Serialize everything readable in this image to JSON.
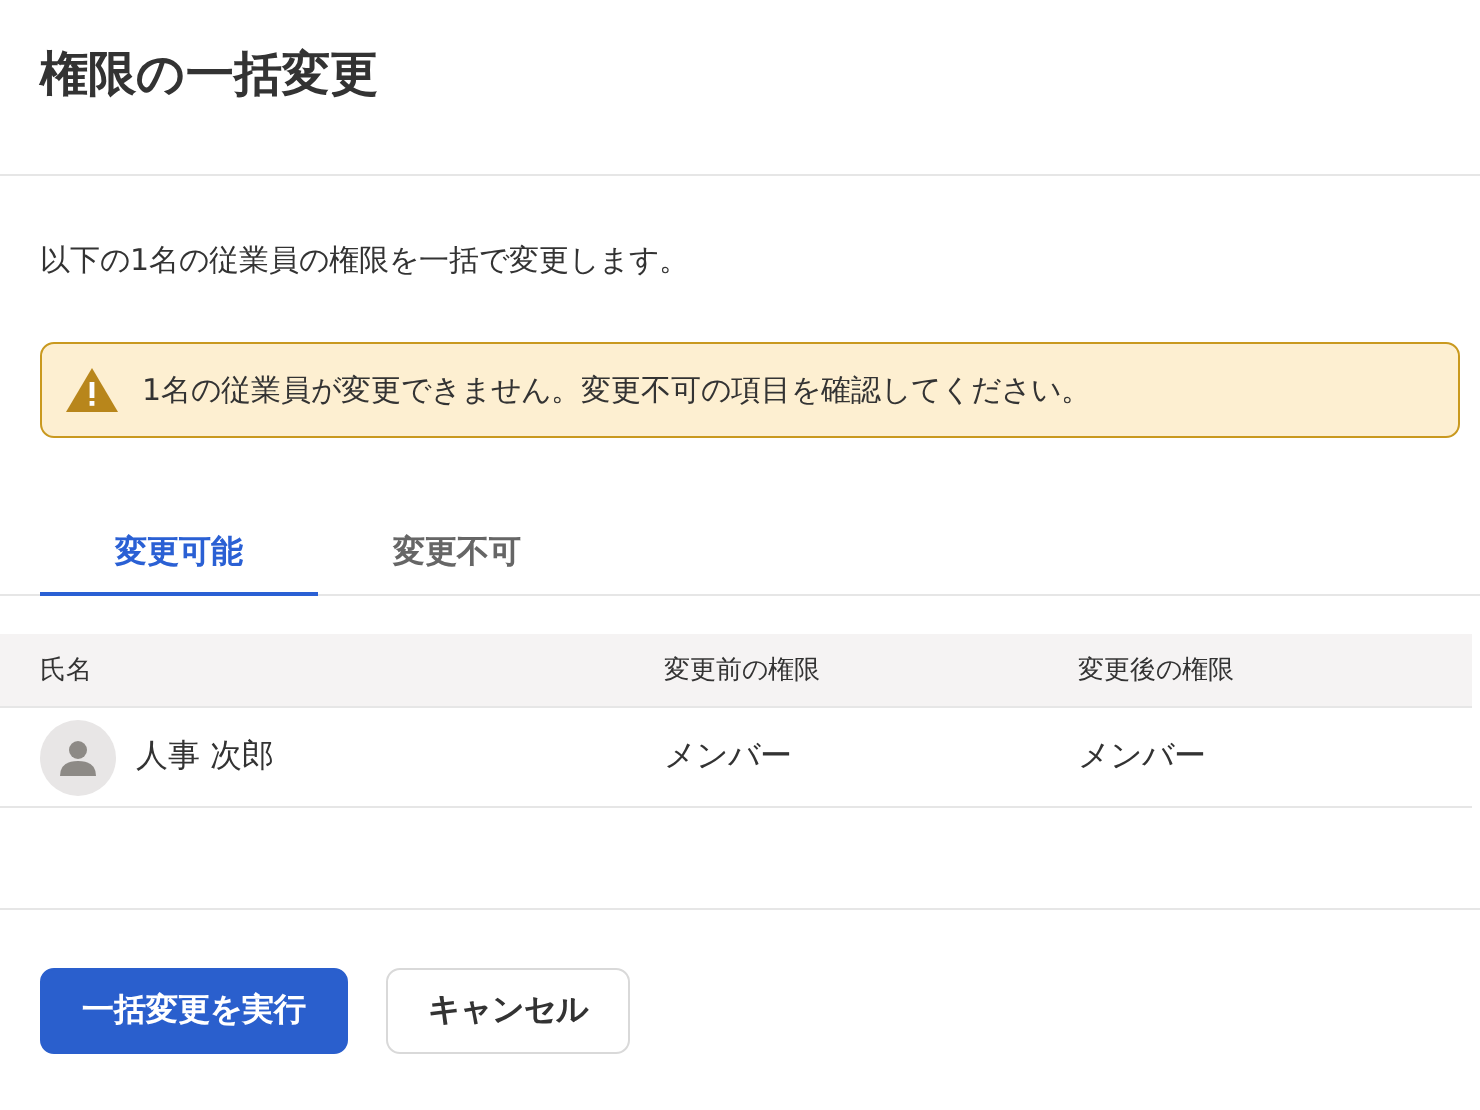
{
  "title": "権限の一括変更",
  "description": "以下の1名の従業員の権限を一括で変更します。",
  "alert": {
    "kind": "warning",
    "message": "1名の従業員が変更できません。変更不可の項目を確認してください。"
  },
  "tabs": [
    {
      "label": "変更可能",
      "selected": true
    },
    {
      "label": "変更不可",
      "selected": false
    }
  ],
  "table": {
    "columns": [
      "氏名",
      "変更前の権限",
      "変更後の権限"
    ],
    "rows": [
      {
        "name": "人事 次郎",
        "before": "メンバー",
        "after": "メンバー"
      }
    ]
  },
  "buttons": [
    {
      "label": "一括変更を実行",
      "kind": "primary"
    },
    {
      "label": "キャンセル",
      "kind": "secondary"
    }
  ]
}
